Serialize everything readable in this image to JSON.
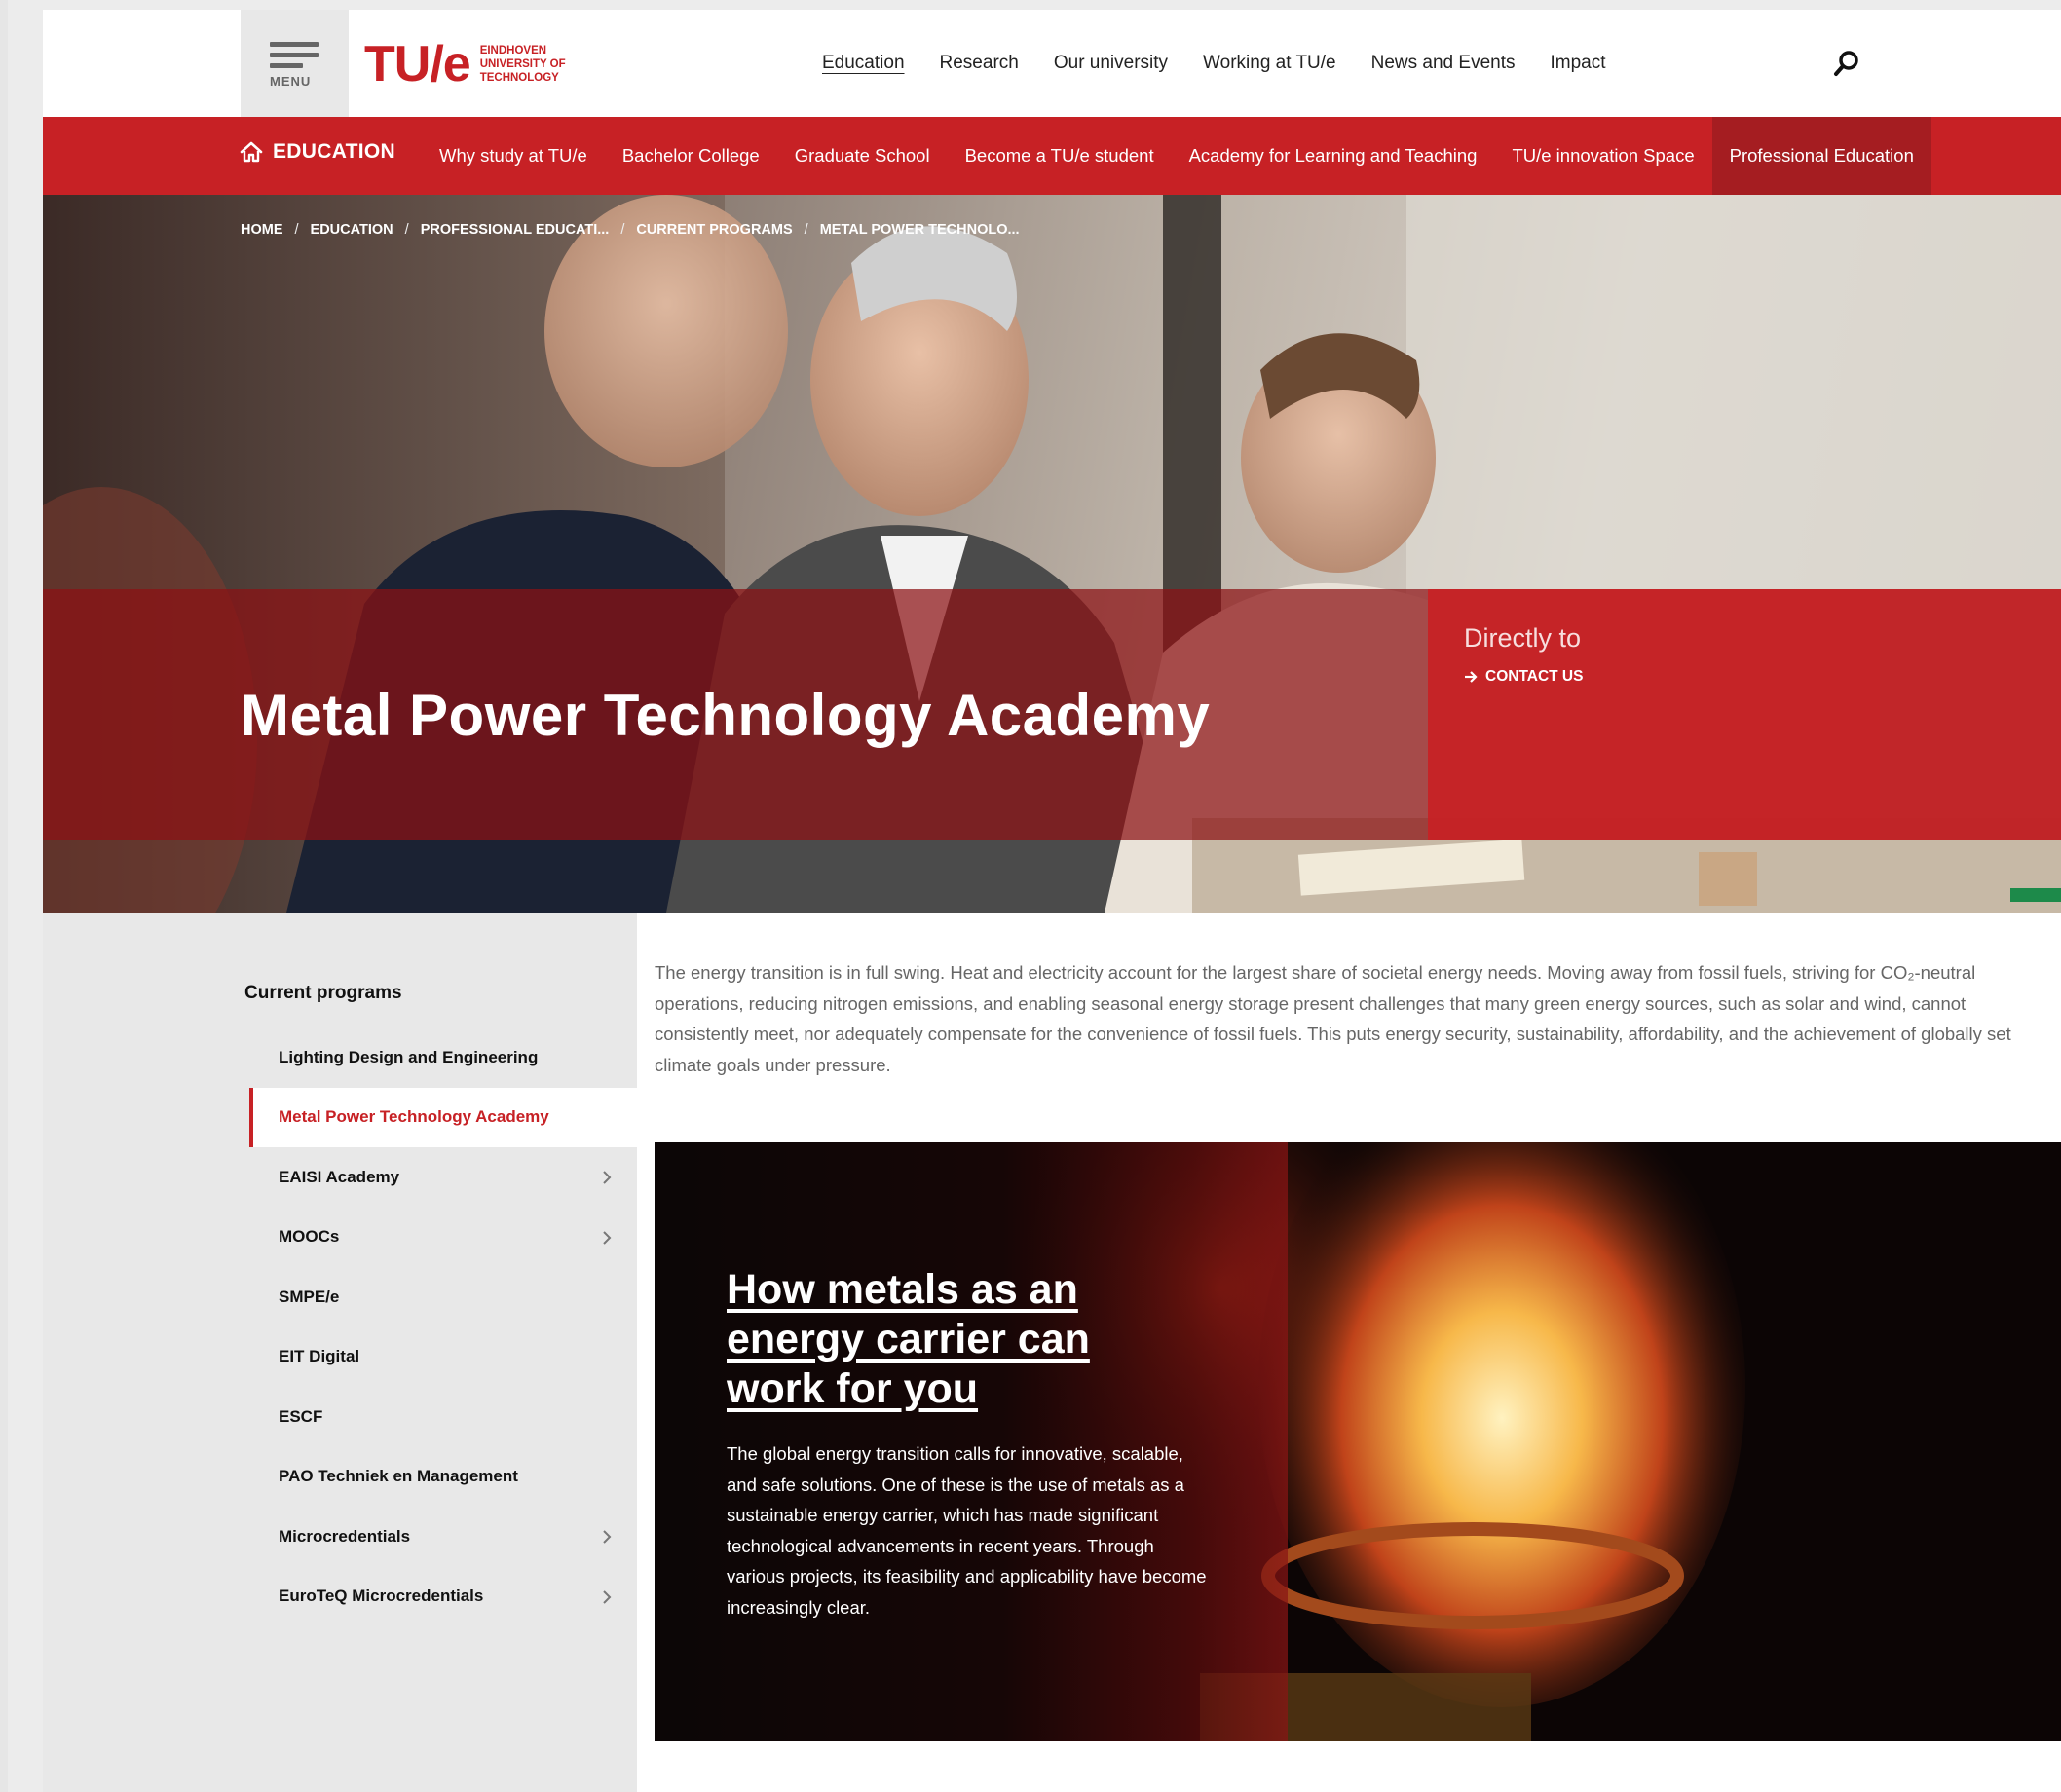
{
  "colors": {
    "brand_red": "#c72125",
    "dark_red": "#a51d21"
  },
  "topbar": {
    "menu_label": "MENU",
    "logo_mark": "TU/e",
    "logo_lines": [
      "EINDHOVEN",
      "UNIVERSITY OF",
      "TECHNOLOGY"
    ],
    "nav": [
      {
        "label": "Education",
        "active": true
      },
      {
        "label": "Research"
      },
      {
        "label": "Our university"
      },
      {
        "label": "Working at TU/e"
      },
      {
        "label": "News and Events"
      },
      {
        "label": "Impact"
      }
    ],
    "search_icon": "search-icon"
  },
  "subnav": {
    "home_icon": "home-icon",
    "home_label": "EDUCATION",
    "items": [
      {
        "label": "Why study at TU/e"
      },
      {
        "label": "Bachelor College"
      },
      {
        "label": "Graduate School"
      },
      {
        "label": "Become a TU/e student"
      },
      {
        "label": "Academy for Learning and Teaching"
      },
      {
        "label": "TU/e innovation Space"
      },
      {
        "label": "Professional Education",
        "active": true
      }
    ]
  },
  "breadcrumb": [
    "HOME",
    "EDUCATION",
    "PROFESSIONAL EDUCATI...",
    "CURRENT PROGRAMS",
    "METAL POWER TECHNOLO..."
  ],
  "hero": {
    "title": "Metal Power Technology Academy",
    "directly_to": "Directly to",
    "contact": "CONTACT US"
  },
  "sidebar": {
    "title": "Current programs",
    "items": [
      {
        "label": "Lighting Design and Engineering",
        "chevron": false
      },
      {
        "label": "Metal Power Technology Academy",
        "chevron": false,
        "active": true
      },
      {
        "label": "EAISI Academy",
        "chevron": true
      },
      {
        "label": "MOOCs",
        "chevron": true
      },
      {
        "label": "SMPE/e",
        "chevron": false
      },
      {
        "label": "EIT Digital",
        "chevron": false
      },
      {
        "label": "ESCF",
        "chevron": false
      },
      {
        "label": "PAO Techniek en Management",
        "chevron": false
      },
      {
        "label": "Microcredentials",
        "chevron": true
      },
      {
        "label": "EuroTeQ Microcredentials",
        "chevron": true
      }
    ]
  },
  "intro_text": "The energy transition is in full swing. Heat and electricity account for the largest share of societal energy needs. Moving away from fossil fuels, striving for CO₂-neutral operations, reducing nitrogen emissions, and enabling seasonal energy storage present challenges that many green energy sources, such as solar and wind, cannot consistently meet, nor adequately compensate for the convenience of fossil fuels. This puts energy security, sustainability, affordability, and the achievement of globally set climate goals under pressure.",
  "feature": {
    "title": "How metals as an energy carrier can work for you",
    "text": "The global energy transition calls for innovative, scalable, and safe solutions. One of these is the use of metals as a sustainable energy carrier, which has made significant technological advancements in recent years. Through various projects, its feasibility and applicability have become increasingly clear."
  }
}
